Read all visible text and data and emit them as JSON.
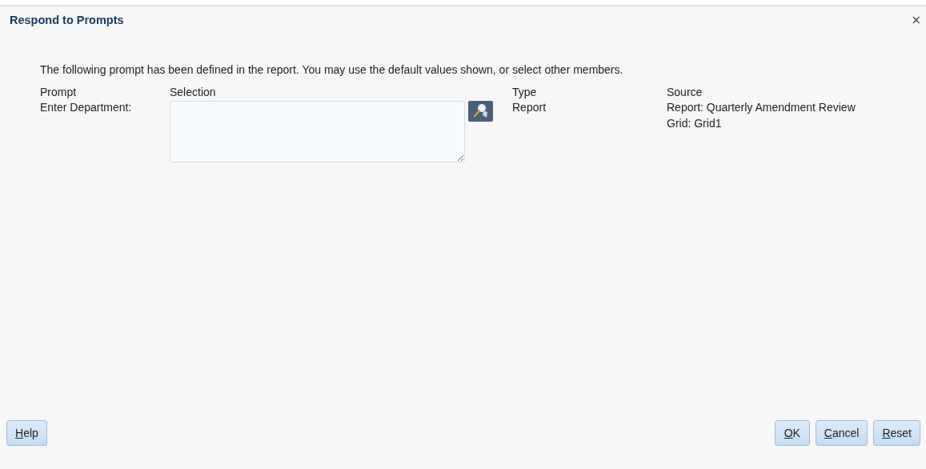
{
  "dialog": {
    "title": "Respond to Prompts",
    "close": "×"
  },
  "intro": "The following prompt has been defined in the report. You may use the default values shown, or select other members.",
  "table": {
    "columns": [
      "Prompt",
      "Selection",
      "Type",
      "Source"
    ],
    "rows": [
      {
        "prompt": "Enter Department:",
        "type": "Report",
        "source": [
          "Report: Quarterly Amendment Review",
          "Grid: Grid1"
        ]
      }
    ]
  },
  "buttons_left": [
    "Help"
  ],
  "buttons_right": [
    "OK",
    "Cancel",
    "Reset"
  ]
}
